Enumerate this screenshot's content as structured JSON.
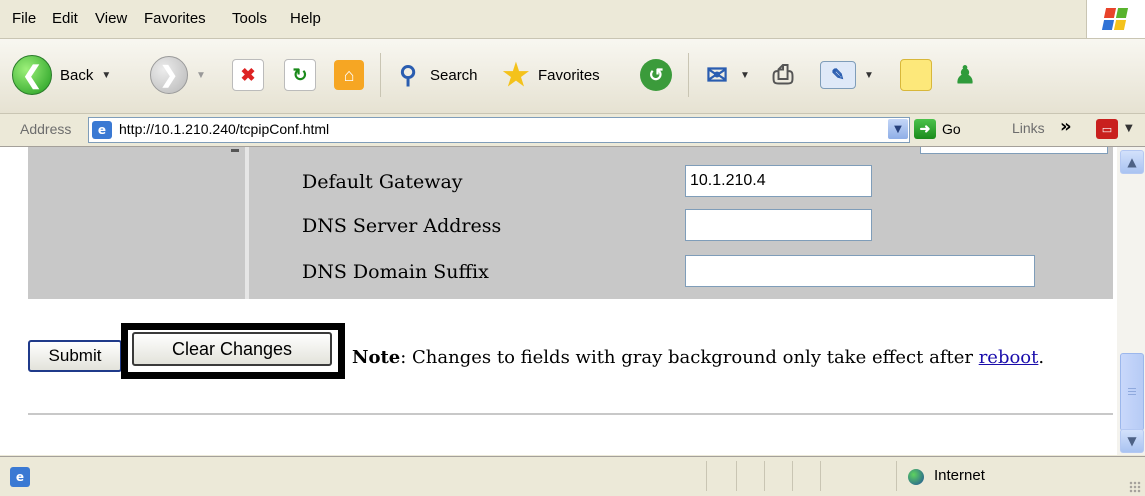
{
  "menubar": {
    "items": [
      "File",
      "Edit",
      "View",
      "Favorites",
      "Tools",
      "Help"
    ]
  },
  "toolbar": {
    "back_label": "Back",
    "search_label": "Search",
    "favorites_label": "Favorites"
  },
  "addressbar": {
    "label": "Address",
    "url": "http://10.1.210.240/tcpipConf.html",
    "go_label": "Go",
    "links_label": "Links"
  },
  "form": {
    "fields": [
      {
        "label": "Default Gateway",
        "value": "10.1.210.4"
      },
      {
        "label": "DNS Server Address",
        "value": ""
      },
      {
        "label": "DNS Domain Suffix",
        "value": ""
      }
    ],
    "submit_label": "Submit",
    "clear_label": "Clear Changes",
    "note_bold": "Note",
    "note_text": ": Changes to fields with gray background only take effect after ",
    "note_link": "reboot",
    "note_end": "."
  },
  "statusbar": {
    "zone_label": "Internet"
  },
  "colors": {
    "gray_background": "#c8c8c8",
    "highlight_frame": "#000000",
    "link": "#1a0dab"
  }
}
